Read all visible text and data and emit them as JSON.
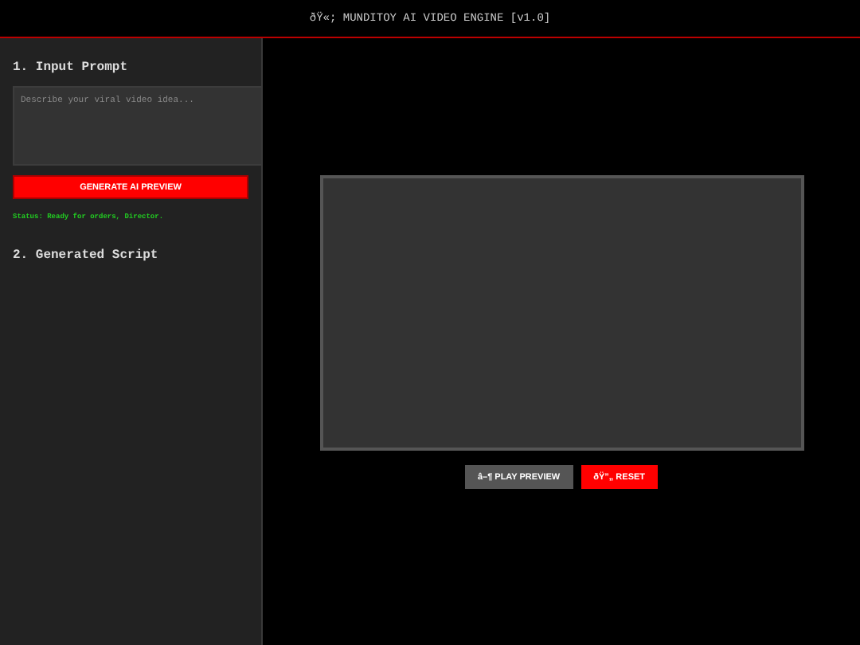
{
  "header": {
    "title": "ðŸ«; MUNDITOY AI VIDEO ENGINE [v1.0]"
  },
  "sidebar": {
    "prompt_heading": "1. Input Prompt",
    "prompt": {
      "placeholder": "Describe your viral video idea..."
    },
    "generate_button": "GENERATE AI PREVIEW",
    "status": "Status: Ready for orders, Director.",
    "script_heading": "2. Generated Script"
  },
  "player": {
    "buttons": [
      {
        "label": "â–¶ PLAY PREVIEW",
        "kind": "play"
      },
      {
        "label": "ðŸ”„ RESET",
        "kind": "reset"
      }
    ]
  }
}
